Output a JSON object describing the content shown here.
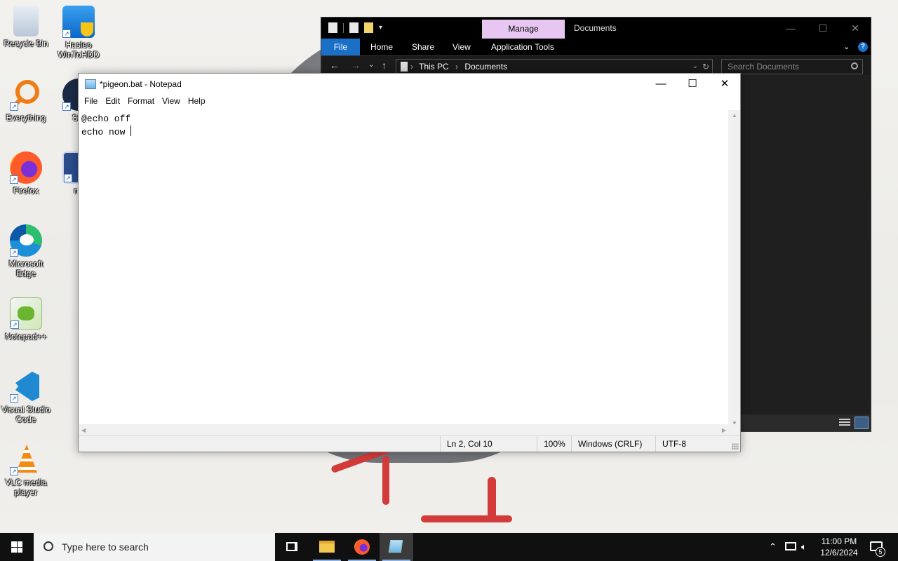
{
  "desktop": {
    "icons": [
      {
        "label": "Recycle Bin"
      },
      {
        "label": "Hasleo WinToHDD"
      },
      {
        "label": "Everything"
      },
      {
        "label": "Ste"
      },
      {
        "label": "Firefox"
      },
      {
        "label": "na"
      },
      {
        "label": "Microsoft Edge"
      },
      {
        "label": "Notepad++"
      },
      {
        "label": "Visual Studio Code"
      },
      {
        "label": "VLC media player"
      }
    ]
  },
  "explorer": {
    "manage_tab": "Manage",
    "title": "Documents",
    "ribbon": {
      "file": "File",
      "home": "Home",
      "share": "Share",
      "view": "View",
      "app_tools": "Application Tools"
    },
    "address": {
      "crumb1": "This PC",
      "crumb2": "Documents"
    },
    "search_placeholder": "Search Documents"
  },
  "notepad": {
    "title": "*pigeon.bat - Notepad",
    "menu": {
      "file": "File",
      "edit": "Edit",
      "format": "Format",
      "view": "View",
      "help": "Help"
    },
    "content": {
      "line1": "@echo off",
      "line2": "echo now "
    },
    "status": {
      "position": "Ln 2, Col 10",
      "zoom": "100%",
      "line_ending": "Windows (CRLF)",
      "encoding": "UTF-8"
    }
  },
  "taskbar": {
    "search_placeholder": "Type here to search",
    "time": "11:00 PM",
    "date": "12/6/2024",
    "notification_count": "5"
  },
  "colors": {
    "accent": "#1a6fc7",
    "manage_tab": "#e7c6f2",
    "taskbar": "#101010"
  }
}
